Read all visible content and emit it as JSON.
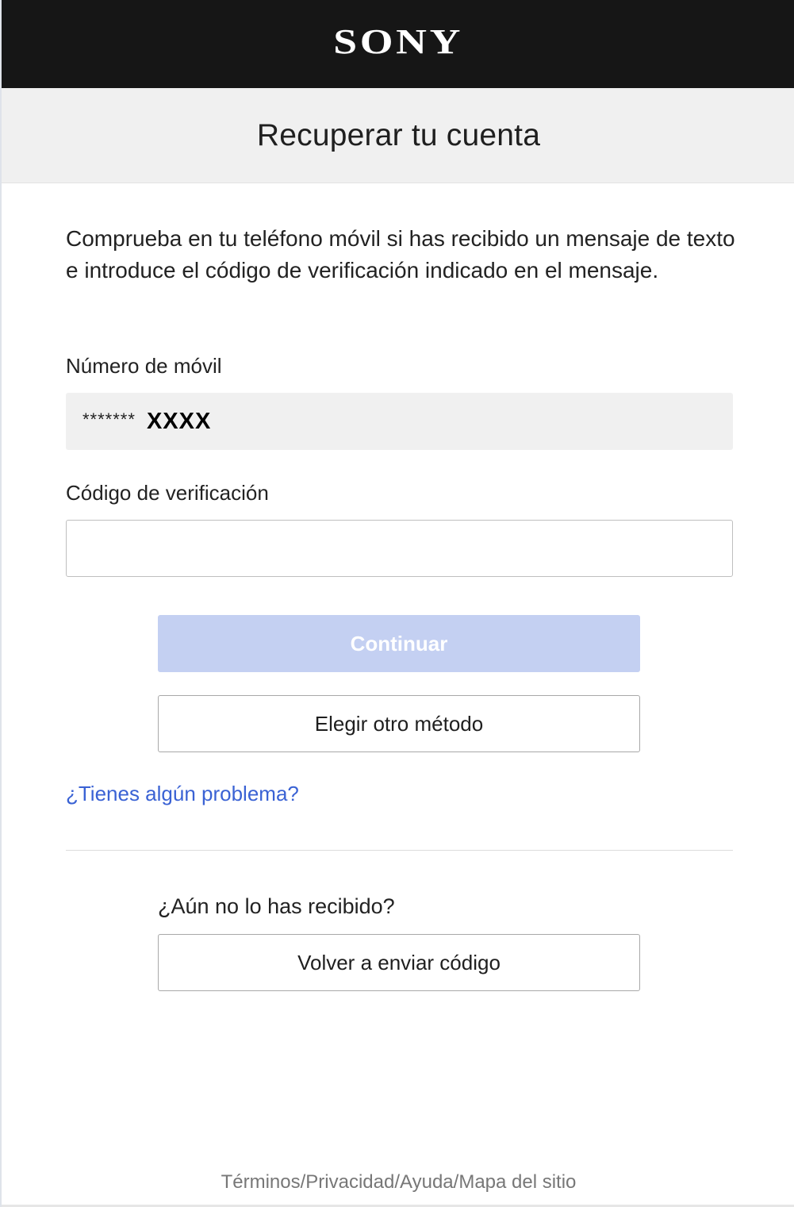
{
  "header": {
    "logo_text": "SONY"
  },
  "title_band": {
    "title": "Recuperar tu cuenta"
  },
  "main": {
    "instructions": "Comprueba en tu teléfono móvil si has recibido un mensaje de texto e introduce el código de verificación indicado en el mensaje.",
    "phone_label": "Número de móvil",
    "phone_mask": "*******",
    "phone_last_digits": "XXXX",
    "code_label": "Código de verificación",
    "code_value": "",
    "continue_label": "Continuar",
    "other_method_label": "Elegir otro método",
    "help_link_label": "¿Tienes algún problema?",
    "not_received_label": "¿Aún no lo has recibido?",
    "resend_label": "Volver a enviar código"
  },
  "footer": {
    "terms": "Términos",
    "privacy": "Privacidad",
    "help": "Ayuda",
    "sitemap": "Mapa del sitio",
    "separator": "/"
  },
  "colors": {
    "header_bg": "#161616",
    "title_band_bg": "#f0f0f0",
    "primary_button_disabled": "#c4d0f2",
    "link": "#3a62d4",
    "footer_text": "#777777"
  }
}
